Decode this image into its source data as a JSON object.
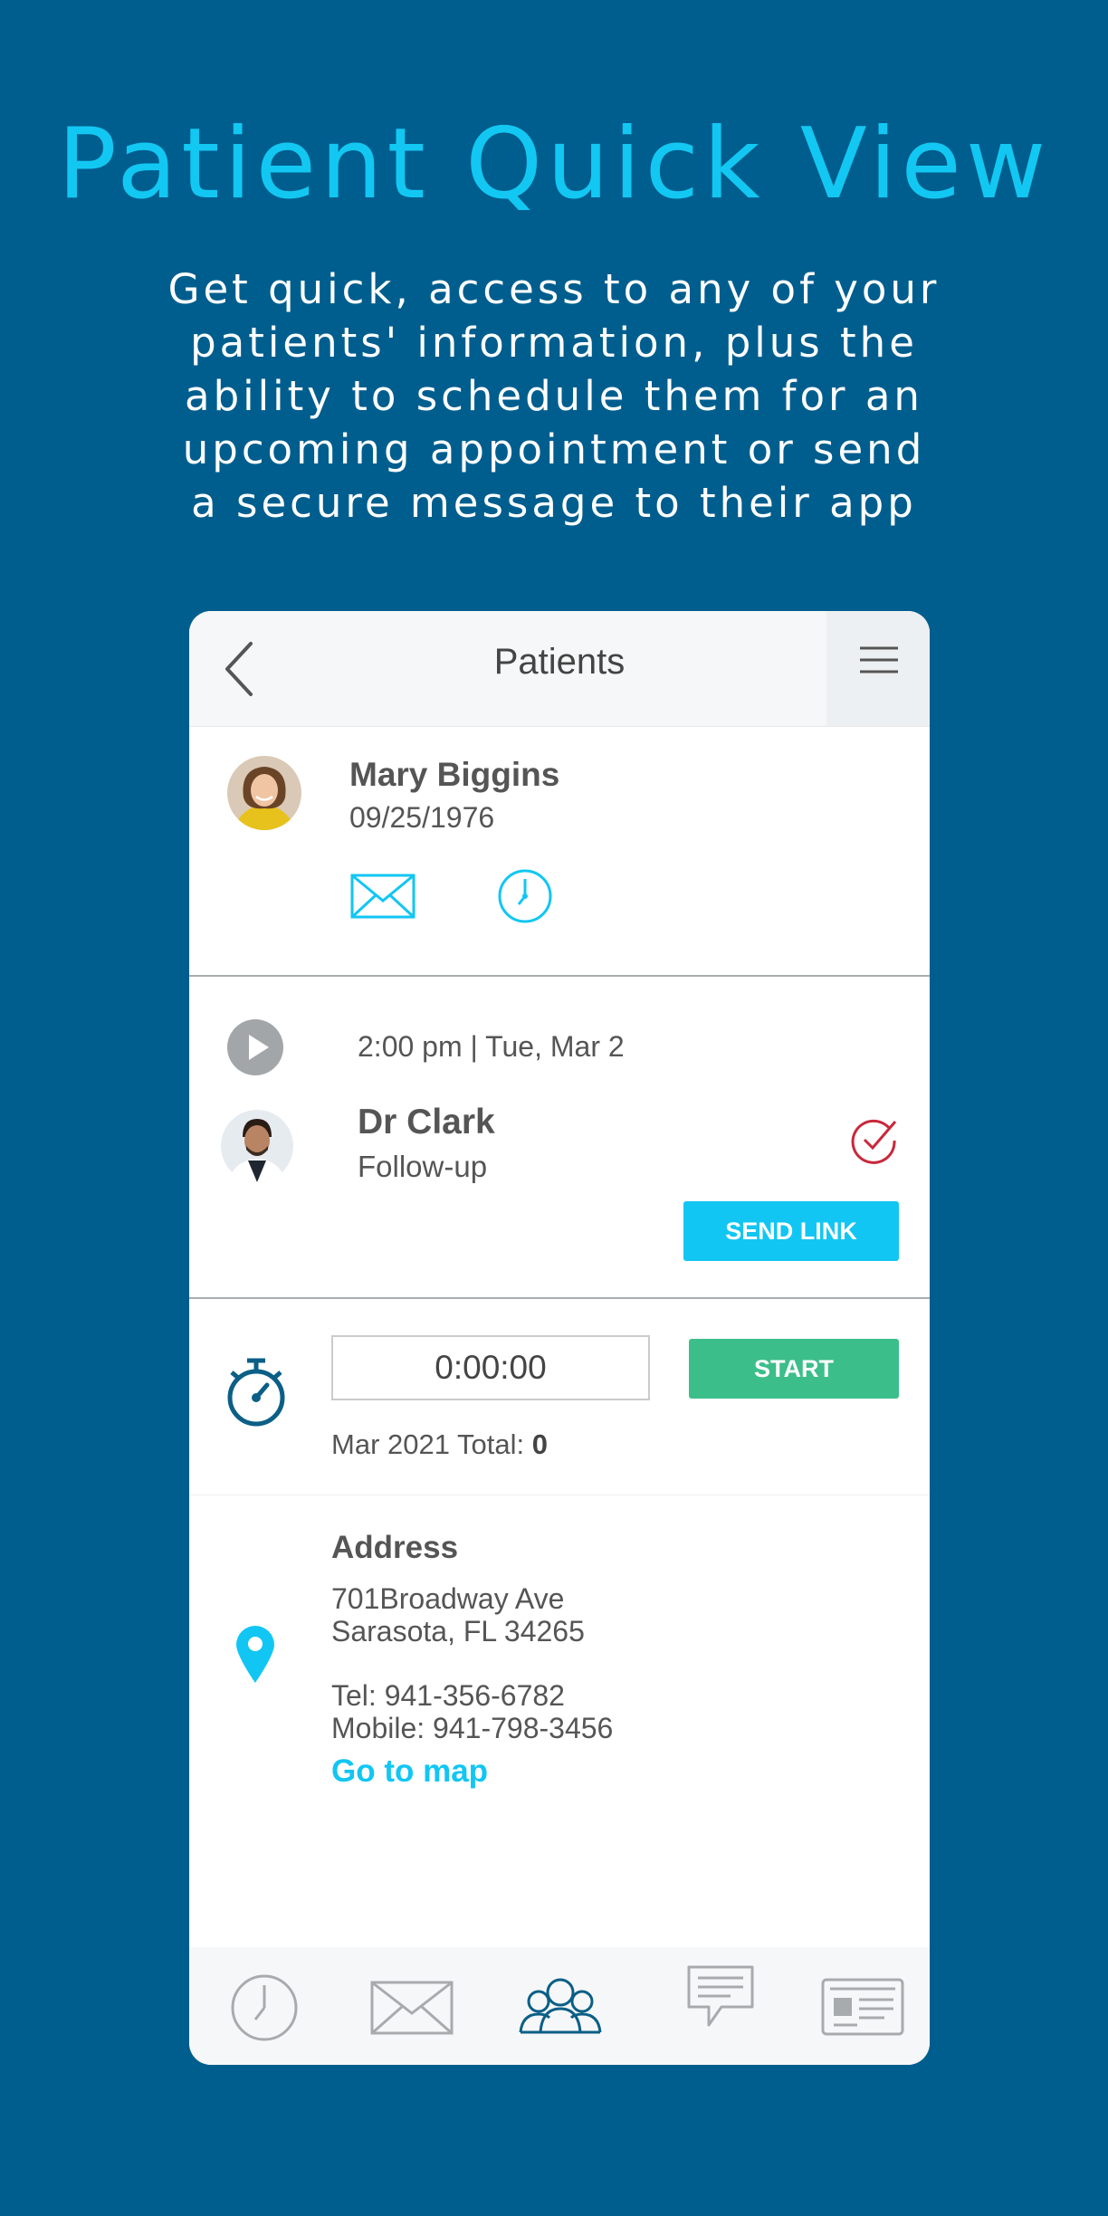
{
  "promo": {
    "headline": "Patient Quick View",
    "subtitle": "Get quick, access to any of your patients' information, plus the ability to schedule them for an upcoming appointment or send a secure message to their app"
  },
  "header": {
    "title": "Patients",
    "back_icon": "chevron-left-icon",
    "menu_icon": "hamburger-menu-icon"
  },
  "patient": {
    "name": "Mary Biggins",
    "dob": "09/25/1976",
    "actions": [
      "mail-icon",
      "clock-icon"
    ]
  },
  "appointment": {
    "time": "2:00 pm | Tue, Mar 2",
    "doctor": "Dr Clark",
    "type": "Follow-up",
    "send_link_label": "SEND LINK"
  },
  "timer": {
    "value": "0:00:00",
    "start_label": "START",
    "month_total_label": "Mar 2021 Total: ",
    "month_total_value": "0"
  },
  "address": {
    "heading": "Address",
    "street": "701Broadway Ave",
    "city_state": "Sarasota, FL  34265",
    "tel": "Tel: 941-356-6782",
    "mobile": "Mobile: 941-798-3456",
    "map_link": "Go to map"
  },
  "bottom_nav": {
    "items": [
      "clock-icon",
      "mail-icon",
      "patients-icon",
      "chat-icon",
      "id-card-icon"
    ],
    "active": "patients-icon"
  },
  "colors": {
    "background": "#005e8e",
    "accent": "#12c6f3",
    "start": "#3cbe8a",
    "check": "#c9283b",
    "active_nav": "#0b5f86"
  }
}
